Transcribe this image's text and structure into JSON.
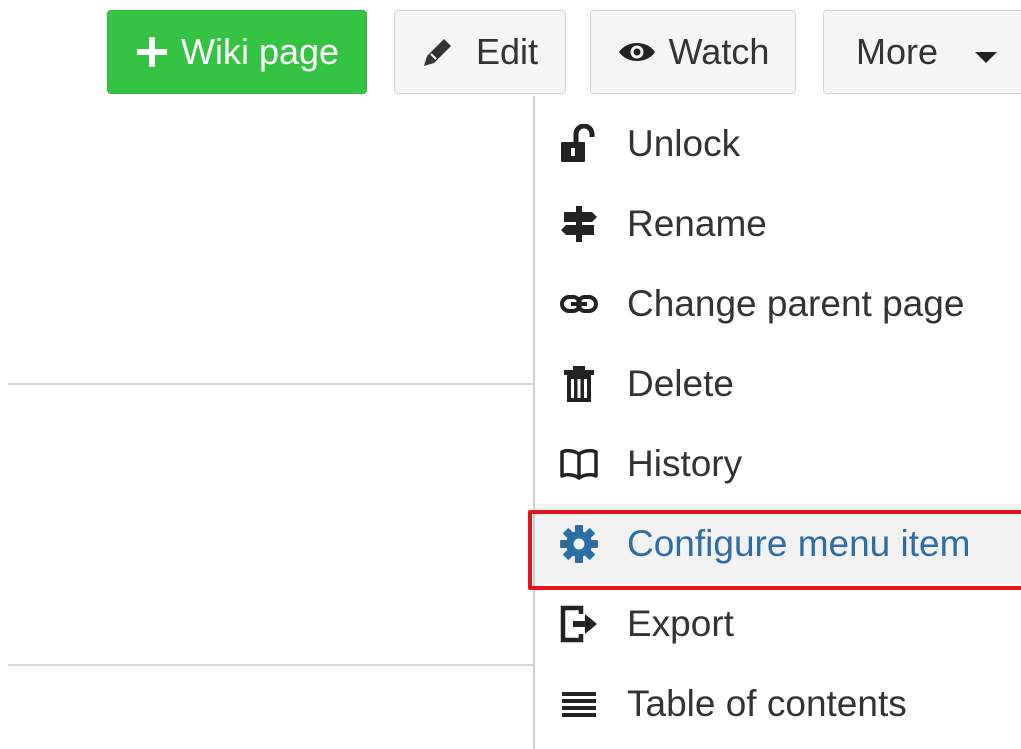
{
  "toolbar": {
    "wiki_page_label": "Wiki page",
    "edit_label": "Edit",
    "watch_label": "Watch",
    "more_label": "More"
  },
  "menu": {
    "items": [
      {
        "label": "Unlock",
        "icon": "unlock-icon"
      },
      {
        "label": "Rename",
        "icon": "signpost-icon"
      },
      {
        "label": "Change parent page",
        "icon": "link-icon"
      },
      {
        "label": "Delete",
        "icon": "trash-icon"
      },
      {
        "label": "History",
        "icon": "book-icon"
      },
      {
        "label": "Configure menu item",
        "icon": "gear-icon",
        "highlighted": true
      },
      {
        "label": "Export",
        "icon": "export-icon"
      },
      {
        "label": "Table of contents",
        "icon": "list-icon"
      }
    ]
  },
  "colors": {
    "primary_button": "#35c343",
    "highlight_text": "#2c6ea3",
    "highlight_outline": "#e8131b"
  }
}
